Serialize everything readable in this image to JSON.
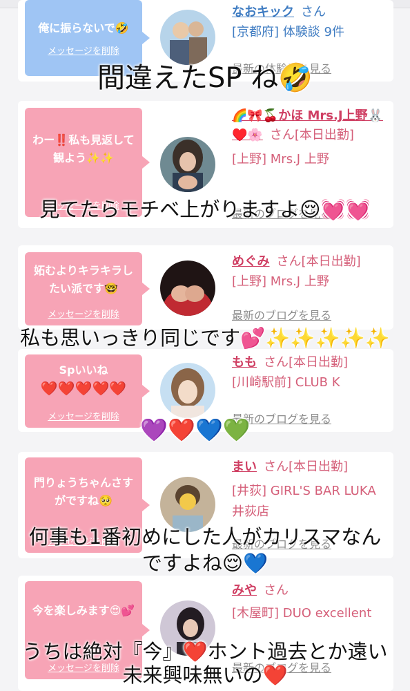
{
  "cards": [
    {
      "message": "俺に振らないで🤣",
      "delete_label": "メッセージを削除",
      "name": "なおキック",
      "honorific": "さん",
      "shop": "[京都府] 体験談 9件",
      "link": "最新の体験談を見る"
    },
    {
      "message": "わー‼️私も見返して観よう✨✨",
      "delete_label": "メッセージを削除",
      "name": "🌈🎀🍒かほ Mrs.J上野🐰♥️🌸",
      "honorific": "さん[本日出勤]",
      "shop": "[上野] Mrs.J 上野",
      "link": "最新のブログを見る"
    },
    {
      "message": "妬むよりキラキラしたい派です🤓",
      "delete_label": "メッセージを削除",
      "name": "めぐみ",
      "honorific": "さん[本日出勤]",
      "shop": "[上野] Mrs.J 上野",
      "link": "最新のブログを見る"
    },
    {
      "message": "Spいいね",
      "message2": "❤️❤️❤️❤️❤️",
      "delete_label": "メッセージを削除",
      "name": "もも",
      "honorific": "さん[本日出勤]",
      "shop": "[川崎駅前] CLUB K",
      "link": "最新のブログを見る"
    },
    {
      "message": "門りょうちゃんさすがですね🥺",
      "delete_label": "メッセージを削除",
      "name": "まい",
      "honorific": "さん[本日出勤]",
      "shop": "[井荻] GIRL'S BAR LUKA　井荻店",
      "link": "最新のブログを見る"
    },
    {
      "message": "今を楽しみます😍💕",
      "delete_label": "メッセージを削除",
      "name": "みや",
      "honorific": "さん",
      "shop": "[木屋町] DUO excellent",
      "link": "最新のブログを見る"
    }
  ],
  "overlays": {
    "o1": "間違えたSP ね🤣",
    "o2": "見てたらモチベ上がりますよ😌💓💓",
    "o3": "私も思いっきり同じです💕✨✨✨✨✨",
    "o4": "💜❤️💙💚",
    "o5a": "何事も1番初めにした人がカリスマなん",
    "o5b": "ですよね😌💙",
    "o6a": "うちは絶対『今』❤️ホント過去とか遠い",
    "o6b": "未来興味無いの❤️"
  },
  "colors": {
    "pink_bubble": "#f7a4b6",
    "blue_bubble": "#9fc5f4",
    "name_pink": "#cf3e62",
    "link_gray": "#8c8c8c"
  }
}
